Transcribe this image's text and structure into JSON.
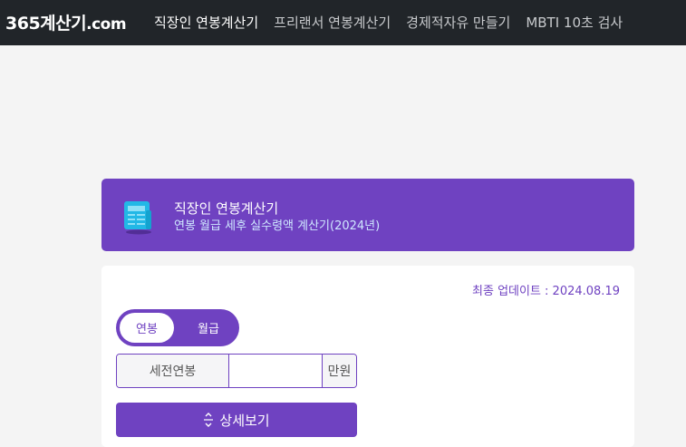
{
  "header": {
    "brand_main": "365계산기",
    "brand_tld": ".com",
    "nav": [
      {
        "label": "직장인 연봉계산기",
        "active": true
      },
      {
        "label": "프리랜서 연봉계산기",
        "active": false
      },
      {
        "label": "경제적자유 만들기",
        "active": false
      },
      {
        "label": "MBTI 10초 검사",
        "active": false
      }
    ]
  },
  "hero": {
    "icon": "newspaper-icon",
    "title": "직장인 연봉계산기",
    "subtitle": "연봉 월급 세후 실수령액 계산기(2024년)"
  },
  "card": {
    "updated": "최종 업데이트 : 2024.08.19",
    "toggle": {
      "annual": "연봉",
      "monthly": "월급",
      "selected": "연봉"
    },
    "salary": {
      "label": "세전연봉",
      "value": "",
      "placeholder": "",
      "unit": "만원"
    },
    "detail_button": {
      "label": "상세보기",
      "icon": "expand-vertical-icon"
    }
  },
  "colors": {
    "header_bg": "#212529",
    "accent": "#6f42c1",
    "hero_subtitle": "#cfe8ff",
    "page_bg": "#f4f4f4"
  }
}
